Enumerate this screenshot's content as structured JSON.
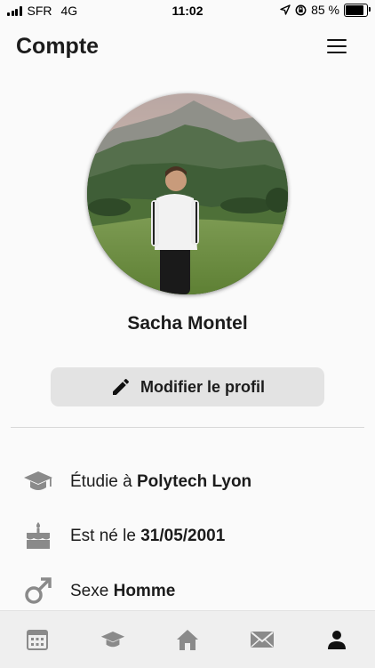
{
  "status_bar": {
    "carrier": "SFR",
    "network": "4G",
    "time": "11:02",
    "battery_percent": "85 %",
    "battery_level": 0.85
  },
  "header": {
    "title": "Compte",
    "menu_icon": "hamburger-menu-icon"
  },
  "profile": {
    "name": "Sacha Montel",
    "edit_button_label": "Modifier le profil",
    "edit_icon": "pencil-icon"
  },
  "info": {
    "education": {
      "icon": "graduation-cap-icon",
      "prefix": "Étudie à ",
      "value": "Polytech Lyon"
    },
    "birth": {
      "icon": "birthday-cake-icon",
      "prefix": "Est né le ",
      "value": "31/05/2001"
    },
    "gender": {
      "icon": "male-icon",
      "prefix": "Sexe ",
      "value": "Homme"
    }
  },
  "tabbar": {
    "tabs": [
      {
        "id": "calendar",
        "icon": "calendar-icon"
      },
      {
        "id": "school",
        "icon": "graduation-cap-icon"
      },
      {
        "id": "home",
        "icon": "home-icon"
      },
      {
        "id": "messages",
        "icon": "envelope-icon"
      },
      {
        "id": "account",
        "icon": "user-icon",
        "active": true
      }
    ],
    "active_color": "#111111",
    "inactive_color": "#8a8a8a"
  },
  "colors": {
    "background": "#fafafa",
    "button_bg": "#e3e3e3",
    "icon_gray": "#8a8a8a",
    "text": "#1c1c1c"
  }
}
